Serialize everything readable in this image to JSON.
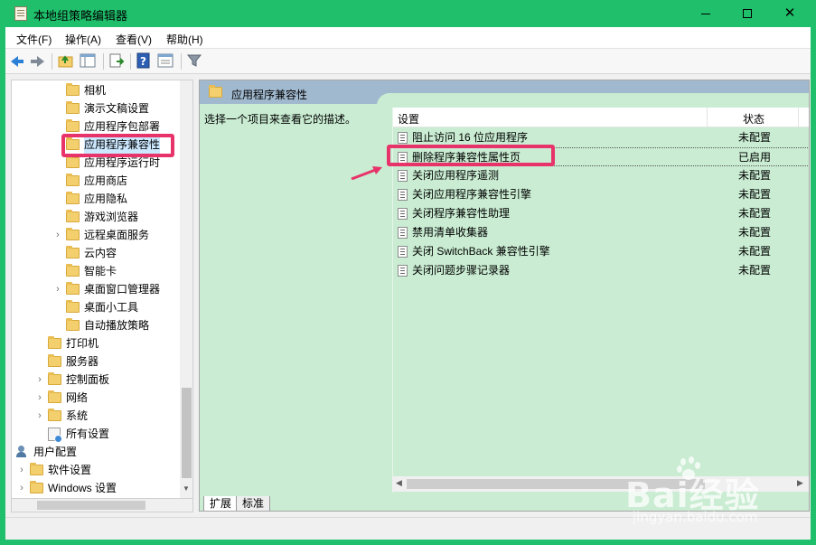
{
  "window": {
    "title": "本地组策略编辑器",
    "accent_color": "#1fbf6b"
  },
  "menu": [
    "文件(F)",
    "操作(A)",
    "查看(V)",
    "帮助(H)"
  ],
  "toolbar": {
    "buttons": [
      "back-icon",
      "forward-icon",
      "up-folder-icon",
      "show-hide-tree-icon",
      "export-list-icon",
      "help-icon",
      "properties-icon",
      "filter-icon"
    ]
  },
  "tree": {
    "items": [
      {
        "label": "相机",
        "indent": 2,
        "expander": "",
        "icon": "folder"
      },
      {
        "label": "演示文稿设置",
        "indent": 2,
        "expander": "",
        "icon": "folder"
      },
      {
        "label": "应用程序包部署",
        "indent": 2,
        "expander": "",
        "icon": "folder"
      },
      {
        "label": "应用程序兼容性",
        "indent": 2,
        "expander": "",
        "icon": "folder",
        "selected": true
      },
      {
        "label": "应用程序运行时",
        "indent": 2,
        "expander": "",
        "icon": "folder"
      },
      {
        "label": "应用商店",
        "indent": 2,
        "expander": "",
        "icon": "folder"
      },
      {
        "label": "应用隐私",
        "indent": 2,
        "expander": "",
        "icon": "folder"
      },
      {
        "label": "游戏浏览器",
        "indent": 2,
        "expander": "",
        "icon": "folder"
      },
      {
        "label": "远程桌面服务",
        "indent": 2,
        "expander": "›",
        "icon": "folder"
      },
      {
        "label": "云内容",
        "indent": 2,
        "expander": "",
        "icon": "folder"
      },
      {
        "label": "智能卡",
        "indent": 2,
        "expander": "",
        "icon": "folder"
      },
      {
        "label": "桌面窗口管理器",
        "indent": 2,
        "expander": "›",
        "icon": "folder"
      },
      {
        "label": "桌面小工具",
        "indent": 2,
        "expander": "",
        "icon": "folder"
      },
      {
        "label": "自动播放策略",
        "indent": 2,
        "expander": "",
        "icon": "folder"
      },
      {
        "label": "打印机",
        "indent": 1,
        "expander": "",
        "icon": "folder"
      },
      {
        "label": "服务器",
        "indent": 1,
        "expander": "",
        "icon": "folder"
      },
      {
        "label": "控制面板",
        "indent": 1,
        "expander": "›",
        "icon": "folder"
      },
      {
        "label": "网络",
        "indent": 1,
        "expander": "›",
        "icon": "folder"
      },
      {
        "label": "系统",
        "indent": 1,
        "expander": "›",
        "icon": "folder"
      },
      {
        "label": "所有设置",
        "indent": 1,
        "expander": "",
        "icon": "settings"
      },
      {
        "label": "用户配置",
        "indent": -1,
        "expander": "",
        "icon": "user"
      },
      {
        "label": "软件设置",
        "indent": 0,
        "expander": "›",
        "icon": "folder"
      },
      {
        "label": "Windows 设置",
        "indent": 0,
        "expander": "›",
        "icon": "folder"
      }
    ]
  },
  "content": {
    "header_title": "应用程序兼容性",
    "description": "选择一个项目来查看它的描述。",
    "columns": {
      "setting": "设置",
      "state": "状态"
    },
    "rows": [
      {
        "name": "阻止访问 16 位应用程序",
        "state": "未配置"
      },
      {
        "name": "删除程序兼容性属性页",
        "state": "已启用"
      },
      {
        "name": "关闭应用程序遥测",
        "state": "未配置"
      },
      {
        "name": "关闭应用程序兼容性引擎",
        "state": "未配置"
      },
      {
        "name": "关闭程序兼容性助理",
        "state": "未配置"
      },
      {
        "name": "禁用清单收集器",
        "state": "未配置"
      },
      {
        "name": "关闭 SwitchBack 兼容性引擎",
        "state": "未配置"
      },
      {
        "name": "关闭问题步骤记录器",
        "state": "未配置"
      }
    ]
  },
  "tabs": [
    "扩展",
    "标准"
  ],
  "annotation_color": "#e8336a",
  "watermark": {
    "main": "Bai经验",
    "sub": "jingyan.baidu.com"
  }
}
